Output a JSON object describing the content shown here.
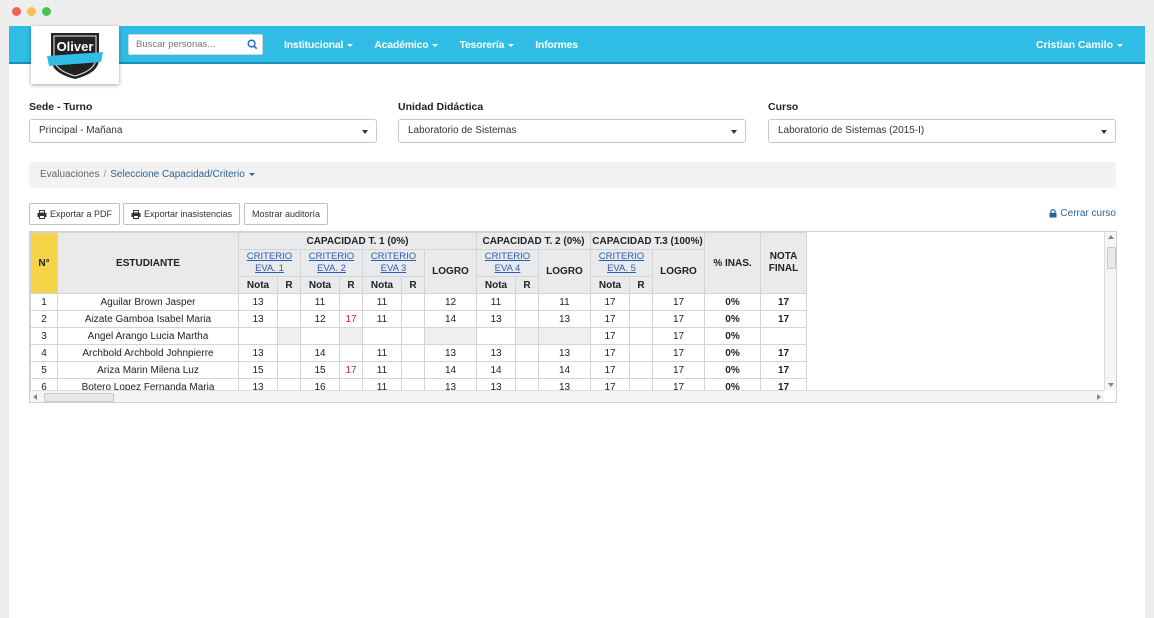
{
  "colors": {
    "navbar": "#2fbde6",
    "accent_link": "#2a6496",
    "num_col": "#f5d44a",
    "alert_red": "#e02020"
  },
  "logo": {
    "text": "Oliver"
  },
  "search": {
    "placeholder": "Buscar personas...",
    "icon": "search-icon"
  },
  "nav": {
    "items": [
      {
        "label": "Institucional",
        "dropdown": true
      },
      {
        "label": "Académico",
        "dropdown": true
      },
      {
        "label": "Tesorería",
        "dropdown": true
      },
      {
        "label": "Informes",
        "dropdown": false
      }
    ],
    "user": "Cristian Camilo"
  },
  "filters": {
    "sede": {
      "label": "Sede - Turno",
      "value": "Principal - Mañana"
    },
    "unidad": {
      "label": "Unidad Didáctica",
      "value": "Laboratorio de Sistemas"
    },
    "curso": {
      "label": "Curso",
      "value": "Laboratorio de Sistemas (2015-I)"
    }
  },
  "breadcrumb": {
    "root": "Evaluaciones",
    "current": "Seleccione Capacidad/Criterio"
  },
  "toolbar": {
    "export_pdf": "Exportar a PDF",
    "export_absences": "Exportar inasistencias",
    "show_audit": "Mostrar auditoría",
    "close_course": "Cerrar curso"
  },
  "grid": {
    "h_num": "N°",
    "h_student": "ESTUDIANTE",
    "cap1": "CAPACIDAD T. 1  (0%)",
    "cap2": "CAPACIDAD T. 2  (0%)",
    "cap3": "CAPACIDAD T.3 (100%)",
    "crit_word": "CRITERIO",
    "eva1": "EVA. 1",
    "eva2": "EVA. 2",
    "eva3": "EVA 3",
    "eva4": "EVA 4",
    "eva5": "EVA. 5",
    "logro": "LOGRO",
    "inas": "% INAS.",
    "nota_final": "NOTA FINAL",
    "nota": "Nota",
    "r": "R",
    "rows": [
      {
        "n": "1",
        "name": "Aguilar Brown Jasper",
        "c1": "13",
        "r1": "",
        "c2": "11",
        "r2": "",
        "c3": "11",
        "r3": "",
        "l1": "12",
        "c4": "11",
        "r4": "",
        "l2": "11",
        "c5": "17",
        "r5": "",
        "l3": "17",
        "inas": "0%",
        "final": "17"
      },
      {
        "n": "2",
        "name": "Aizate Gamboa Isabel Maria",
        "c1": "13",
        "r1": "",
        "c2": "12",
        "r2": "17",
        "c3": "11",
        "r3": "",
        "l1": "14",
        "c4": "13",
        "r4": "",
        "l2": "13",
        "c5": "17",
        "r5": "",
        "l3": "17",
        "inas": "0%",
        "final": "17"
      },
      {
        "n": "3",
        "name": "Angel Arango Lucia Martha",
        "c1": "",
        "r1": "",
        "c2": "",
        "r2": "",
        "c3": "",
        "r3": "",
        "l1": "",
        "c4": "",
        "r4": "",
        "l2": "",
        "c5": "17",
        "r5": "",
        "l3": "17",
        "inas": "0%",
        "final": ""
      },
      {
        "n": "4",
        "name": "Archbold Archbold Johnpierre",
        "c1": "13",
        "r1": "",
        "c2": "14",
        "r2": "",
        "c3": "11",
        "r3": "",
        "l1": "13",
        "c4": "13",
        "r4": "",
        "l2": "13",
        "c5": "17",
        "r5": "",
        "l3": "17",
        "inas": "0%",
        "final": "17"
      },
      {
        "n": "5",
        "name": "Ariza Marin Milena Luz",
        "c1": "15",
        "r1": "",
        "c2": "15",
        "r2": "17",
        "c3": "11",
        "r3": "",
        "l1": "14",
        "c4": "14",
        "r4": "",
        "l2": "14",
        "c5": "17",
        "r5": "",
        "l3": "17",
        "inas": "0%",
        "final": "17"
      },
      {
        "n": "6",
        "name": "Botero Lopez Fernanda Maria",
        "c1": "13",
        "r1": "",
        "c2": "16",
        "r2": "",
        "c3": "11",
        "r3": "",
        "l1": "13",
        "c4": "13",
        "r4": "",
        "l2": "13",
        "c5": "17",
        "r5": "",
        "l3": "17",
        "inas": "0%",
        "final": "17"
      }
    ]
  }
}
